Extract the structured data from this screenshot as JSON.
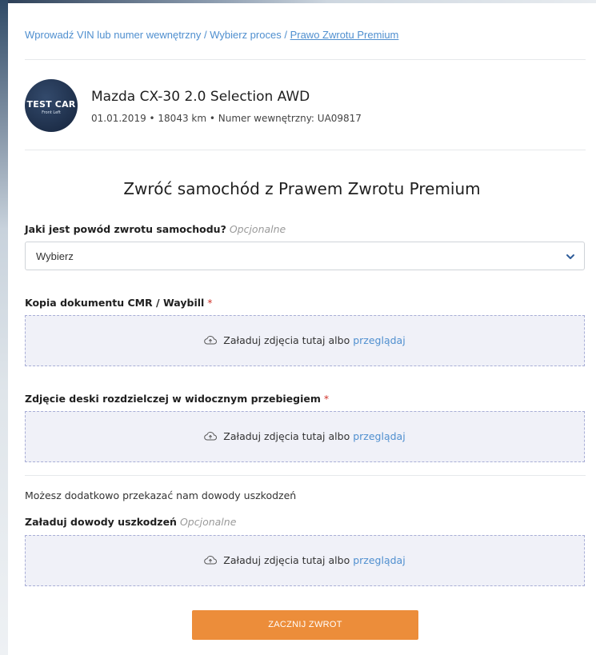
{
  "breadcrumb": {
    "items": [
      {
        "label": "Wprowadź VIN lub numer wewnętrzny"
      },
      {
        "label": "Wybierz proces"
      },
      {
        "label": "Prawo Zwrotu Premium"
      }
    ],
    "separator": "/"
  },
  "car": {
    "avatar_main": "TEST CAR",
    "avatar_sub": "Front Left",
    "title": "Mazda CX-30 2.0 Selection AWD",
    "meta": "01.01.2019 • 18043 km • Numer wewnętrzny: UA09817"
  },
  "page": {
    "title": "Zwróć samochód z Prawem Zwrotu Premium"
  },
  "reason": {
    "label": "Jaki jest powód zwrotu samochodu?",
    "optional": "Opcjonalne",
    "value": "Wybierz"
  },
  "cmr": {
    "label": "Kopia dokumentu CMR / Waybill",
    "required_mark": "*"
  },
  "dashboard": {
    "label": "Zdjęcie deski rozdzielczej w widocznym przebiegiem",
    "required_mark": "*"
  },
  "damage": {
    "hint": "Możesz dodatkowo przekazać nam dowody uszkodzeń",
    "label": "Załaduj dowody uszkodzeń",
    "optional": "Opcjonalne"
  },
  "upload": {
    "text": "Załaduj zdjęcia tutaj albo",
    "link": "przeglądaj"
  },
  "submit": {
    "label": "ZACZNIJ ZWROT"
  },
  "colors": {
    "link": "#4f8fcf",
    "button": "#ec8d3a",
    "required": "#d0342c",
    "dropzone_bg": "#f0f1f8"
  },
  "icons": {
    "select_chevron": "chevron-down-icon",
    "upload": "cloud-upload-icon"
  }
}
